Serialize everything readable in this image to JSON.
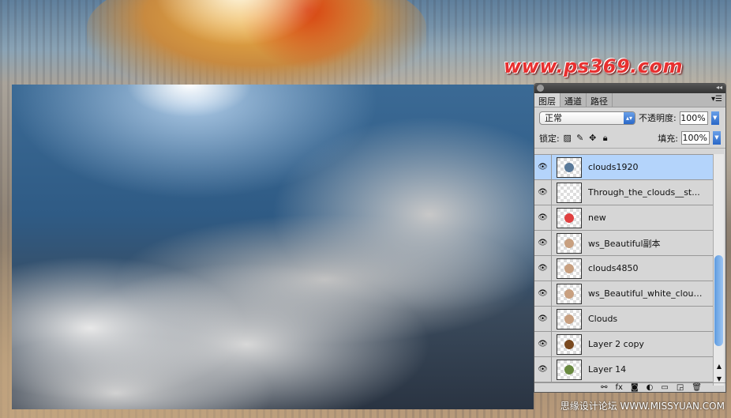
{
  "logo": "www.ps369.com",
  "watermark": "思缘设计论坛 WWW.MISSYUAN.COM",
  "panel": {
    "tabs": [
      {
        "label": "图层",
        "active": true
      },
      {
        "label": "通道"
      },
      {
        "label": "路径"
      }
    ],
    "blend_mode": "正常",
    "opacity_label": "不透明度:",
    "opacity": "100%",
    "lock_label": "锁定:",
    "fill_label": "填充:",
    "fill": "100%",
    "layers": [
      {
        "name": "clouds1920",
        "visible": true,
        "selected": true
      },
      {
        "name": "Through_the_clouds__st...",
        "visible": true
      },
      {
        "name": "new",
        "visible": true
      },
      {
        "name": "ws_Beautiful副本",
        "visible": true
      },
      {
        "name": "clouds4850",
        "visible": true
      },
      {
        "name": "ws_Beautiful_white_cloud...",
        "visible": true
      },
      {
        "name": "Clouds",
        "visible": true
      },
      {
        "name": "Layer 2 copy",
        "visible": true
      },
      {
        "name": "Layer 14",
        "visible": true
      }
    ],
    "bottom_icons": [
      "link-icon",
      "fx-icon",
      "mask-icon",
      "adjustment-icon",
      "group-icon",
      "new-layer-icon",
      "trash-icon"
    ]
  }
}
